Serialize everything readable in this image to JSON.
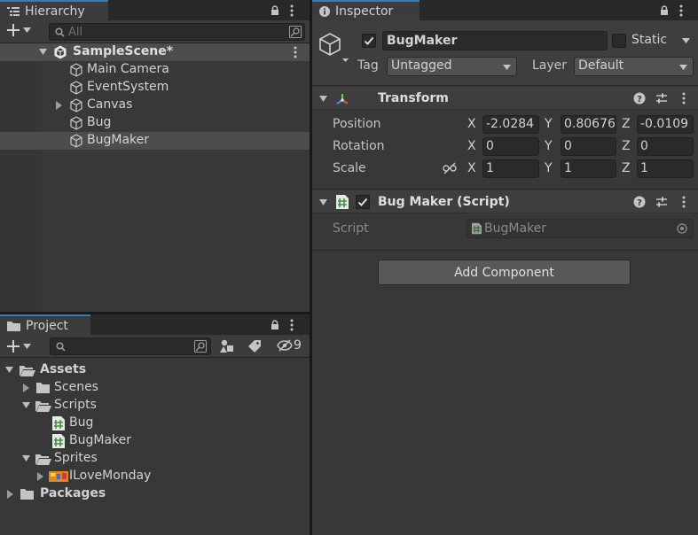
{
  "hierarchy": {
    "tab_title": "Hierarchy",
    "search_placeholder": "All",
    "scene": {
      "name": "SampleScene*"
    },
    "items": [
      {
        "label": "Main Camera"
      },
      {
        "label": "EventSystem"
      },
      {
        "label": "Canvas"
      },
      {
        "label": "Bug"
      },
      {
        "label": "BugMaker"
      }
    ]
  },
  "project": {
    "tab_title": "Project",
    "hidden_count": "9",
    "tree": [
      {
        "label": "Assets"
      },
      {
        "label": "Scenes"
      },
      {
        "label": "Scripts"
      },
      {
        "label": "Bug"
      },
      {
        "label": "BugMaker"
      },
      {
        "label": "Sprites"
      },
      {
        "label": "ILoveMonday"
      },
      {
        "label": "Packages"
      }
    ]
  },
  "inspector": {
    "tab_title": "Inspector",
    "object_name": "BugMaker",
    "static_label": "Static",
    "tag_label": "Tag",
    "tag_value": "Untagged",
    "layer_label": "Layer",
    "layer_value": "Default",
    "transform": {
      "title": "Transform",
      "position_label": "Position",
      "rotation_label": "Rotation",
      "scale_label": "Scale",
      "axis_x": "X",
      "axis_y": "Y",
      "axis_z": "Z",
      "position": {
        "x": "-2.0284",
        "y": "0.80676",
        "z": "-0.0109"
      },
      "rotation": {
        "x": "0",
        "y": "0",
        "z": "0"
      },
      "scale": {
        "x": "1",
        "y": "1",
        "z": "1"
      }
    },
    "script_component": {
      "title": "Bug Maker (Script)",
      "script_label": "Script",
      "script_value": "BugMaker"
    },
    "add_component_label": "Add Component"
  },
  "colors": {
    "accent": "#3a79bb",
    "panel": "#383838",
    "selection": "#4d4d4d"
  }
}
